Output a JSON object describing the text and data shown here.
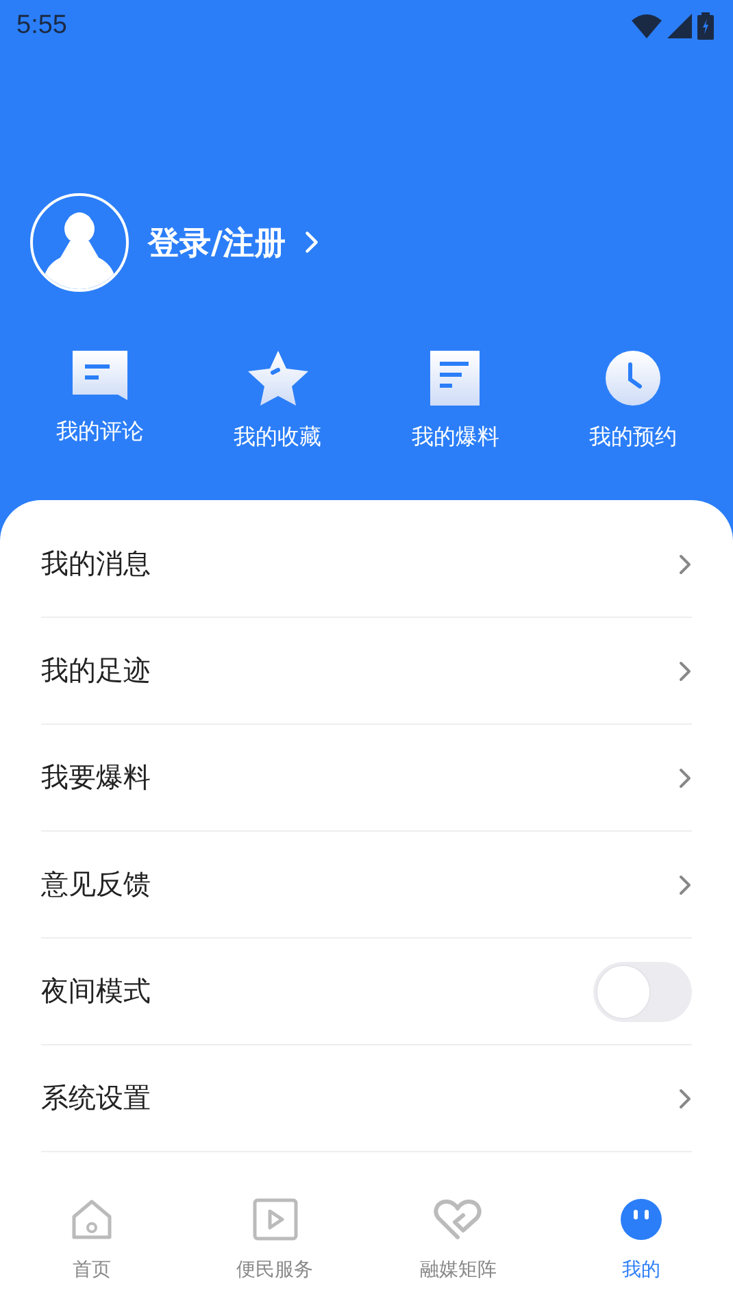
{
  "status_bar": {
    "time": "5:55"
  },
  "profile": {
    "login_label": "登录/注册"
  },
  "shortcuts": [
    {
      "label": "我的评论",
      "kind": "comment"
    },
    {
      "label": "我的收藏",
      "kind": "star"
    },
    {
      "label": "我的爆料",
      "kind": "document"
    },
    {
      "label": "我的预约",
      "kind": "clock"
    }
  ],
  "menu": [
    {
      "label": "我的消息",
      "kind": "link"
    },
    {
      "label": "我的足迹",
      "kind": "link"
    },
    {
      "label": "我要爆料",
      "kind": "link"
    },
    {
      "label": "意见反馈",
      "kind": "link"
    },
    {
      "label": "夜间模式",
      "kind": "toggle",
      "on": false
    },
    {
      "label": "系统设置",
      "kind": "link"
    }
  ],
  "tabs": [
    {
      "label": "首页",
      "kind": "home",
      "selected": false
    },
    {
      "label": "便民服务",
      "kind": "play",
      "selected": false
    },
    {
      "label": "融媒矩阵",
      "kind": "heart",
      "selected": false
    },
    {
      "label": "我的",
      "kind": "face",
      "selected": true
    }
  ]
}
